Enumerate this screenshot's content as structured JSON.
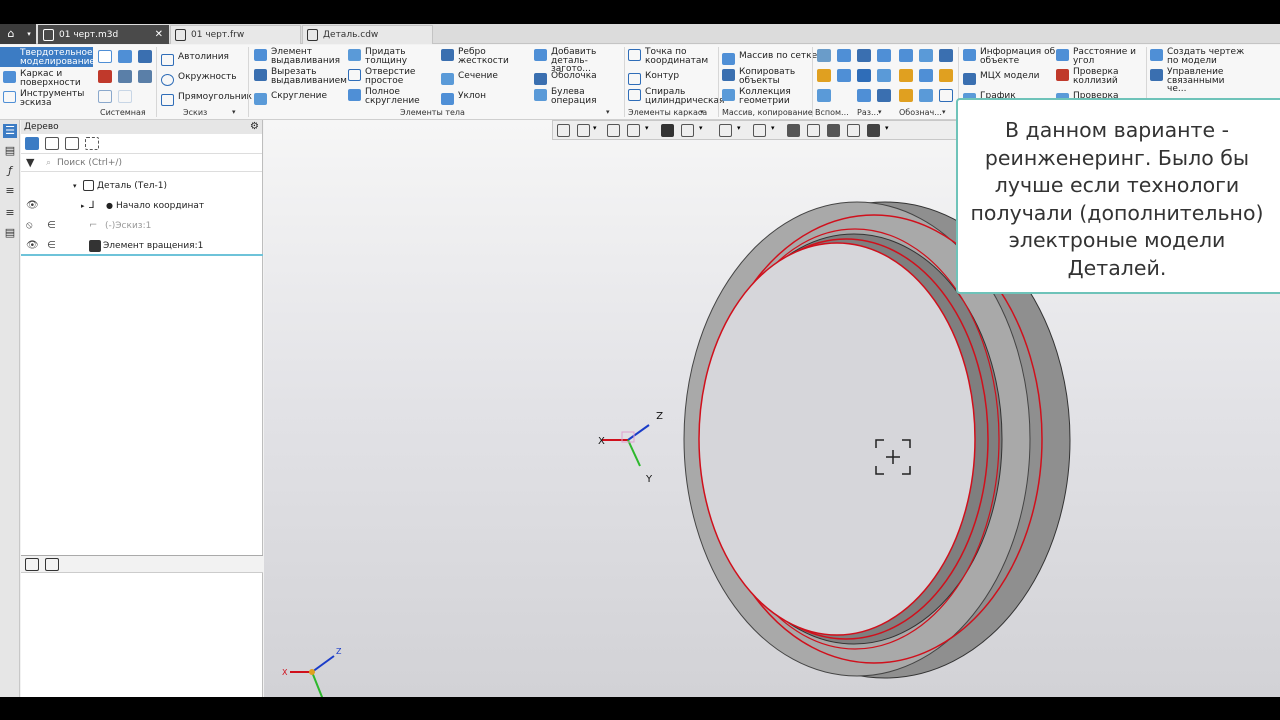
{
  "tabs": [
    {
      "label": "01 черт.m3d",
      "active": true,
      "close": "✕"
    },
    {
      "label": "01 черт.frw",
      "active": false
    },
    {
      "label": "Деталь.cdw",
      "active": false
    }
  ],
  "ribbon": {
    "mode": "Твердотельное моделирование",
    "modes": [
      "Каркас и поверхности",
      "Инструменты эскиза"
    ],
    "sketch": [
      "Автолиния",
      "Окружность",
      "Прямоугольник"
    ],
    "body": [
      "Элемент выдавливания",
      "Вырезать выдавливанием",
      "Скругление",
      "Придать толщину",
      "Отверстие простое",
      "Полное скругление",
      "Ребро жесткости",
      "Сечение",
      "Уклон",
      "Добавить деталь-загото...",
      "Оболочка",
      "Булева операция"
    ],
    "frame": [
      "Точка по координатам",
      "Контур",
      "Спираль цилиндрическая"
    ],
    "copy": [
      "Массив по сетке",
      "Копировать объекты",
      "Коллекция геометрии"
    ],
    "measure": [
      "Информация об объекте",
      "МЦХ модели",
      "График",
      "Расстояние и угол",
      "Проверка коллизий",
      "Проверка"
    ],
    "drawing": [
      "Создать чертеж по модели",
      "Управление связанными че..."
    ],
    "groups": [
      "Системная",
      "Эскиз",
      "Элементы тела",
      "Элементы каркаса",
      "Массив, копирование",
      "Вспом...",
      "Раз...",
      "Обознач..."
    ]
  },
  "tree": {
    "title": "Дерево",
    "search_placeholder": "Поиск (Ctrl+/)",
    "nodes": [
      {
        "label": "Деталь (Тел-1)"
      },
      {
        "label": "Начало координат"
      },
      {
        "label": "(-)Эскиз:1"
      },
      {
        "label": "Элемент вращения:1"
      }
    ]
  },
  "viewport": {
    "axes": {
      "x": "X",
      "y": "Y",
      "z": "Z"
    }
  },
  "callout": {
    "text": "В данном варианте - реинженеринг. Было бы лучше если технологи получали (дополнительно) электроные модели Деталей."
  },
  "colors": {
    "accent": "#3c7cc4",
    "callout_border": "#6ec3b9",
    "edge": "#d0101c",
    "part": "#8f8f8f"
  }
}
